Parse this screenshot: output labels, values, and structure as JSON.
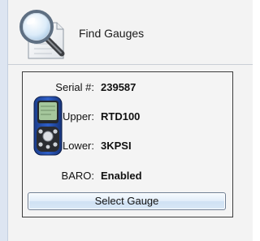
{
  "finder": {
    "label": "Find Gauges",
    "icon": "magnifier-document-icon"
  },
  "gauge": {
    "image_icon": "handheld-gauge-device-icon",
    "fields": [
      {
        "label": "Serial #:",
        "value": "239587"
      },
      {
        "label": "Upper:",
        "value": "RTD100"
      },
      {
        "label": "Lower:",
        "value": "3KPSI"
      },
      {
        "label": "BARO:",
        "value": "Enabled"
      }
    ],
    "select_button": "Select Gauge"
  }
}
